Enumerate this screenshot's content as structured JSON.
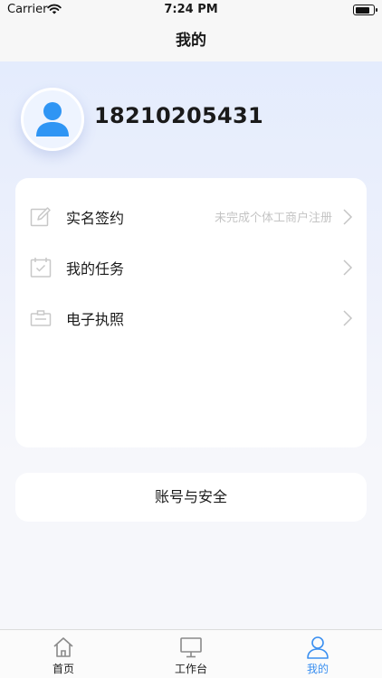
{
  "status_bar": {
    "carrier": "Carrier",
    "time": "7:24 PM"
  },
  "nav": {
    "title": "我的"
  },
  "profile": {
    "phone": "18210205431"
  },
  "menu": {
    "items": [
      {
        "label": "实名签约",
        "hint": "未完成个体工商户注册",
        "icon": "edit-icon"
      },
      {
        "label": "我的任务",
        "hint": "",
        "icon": "calendar-check-icon"
      },
      {
        "label": "电子执照",
        "hint": "",
        "icon": "license-card-icon"
      }
    ]
  },
  "security": {
    "label": "账号与安全"
  },
  "tabs": [
    {
      "label": "首页",
      "icon": "home-icon"
    },
    {
      "label": "工作台",
      "icon": "monitor-icon"
    },
    {
      "label": "我的",
      "icon": "person-icon",
      "active": true
    }
  ],
  "colors": {
    "accent": "#3a8ff0",
    "avatar": "#2f95f4",
    "icon_gray": "#c8c8c8"
  }
}
